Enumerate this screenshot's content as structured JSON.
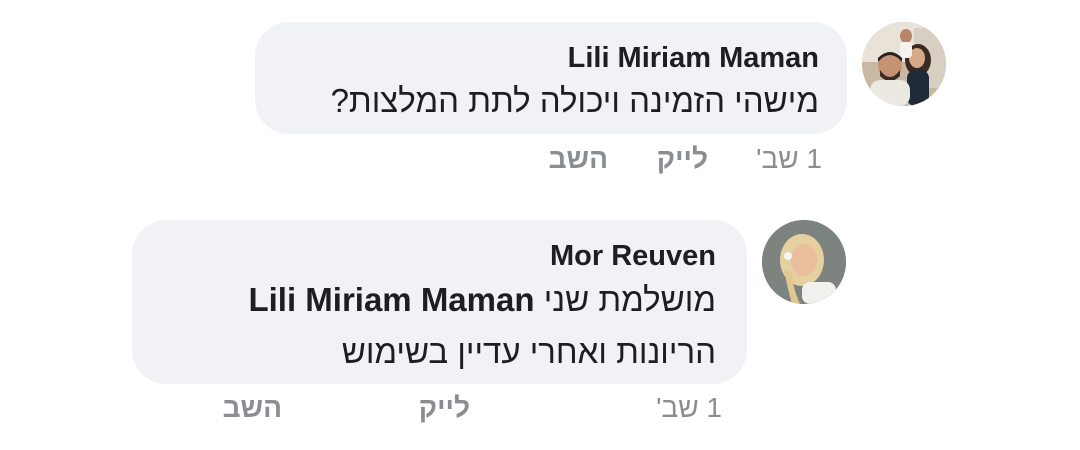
{
  "comments": [
    {
      "author": "Lili Miriam Maman",
      "text": "מישהי הזמינה ויכולה לתת המלצות?",
      "time": "1 שב'",
      "like_label": "לייק",
      "reply_label": "השב",
      "avatar": "profile-photo-couple"
    },
    {
      "author": "Mor Reuven",
      "text_prefix": "מושלמת שני",
      "mention": "Lili Miriam Maman",
      "text_line2": "הריונות ואחרי עדיין בשימוש",
      "time": "1 שב'",
      "like_label": "לייק",
      "reply_label": "השב",
      "avatar": "profile-photo-woman"
    }
  ],
  "colors": {
    "bubble": "#f0f2f5",
    "text": "#1c1e21",
    "meta": "#8a8d91"
  }
}
